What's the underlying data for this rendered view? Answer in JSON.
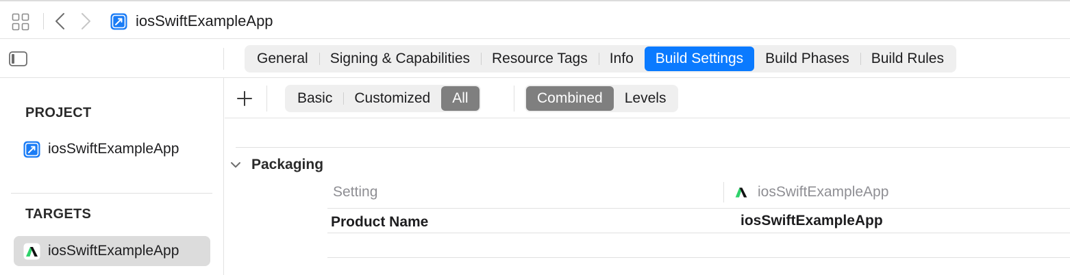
{
  "toolbar": {
    "title": "iosSwiftExampleApp",
    "icons": [
      "grid-icon",
      "back-chevron-icon",
      "forward-chevron-icon",
      "xcode-project-icon"
    ]
  },
  "editor_tabs": [
    {
      "label": "General",
      "active": false
    },
    {
      "label": "Signing & Capabilities",
      "active": false
    },
    {
      "label": "Resource Tags",
      "active": false
    },
    {
      "label": "Info",
      "active": false
    },
    {
      "label": "Build Settings",
      "active": true
    },
    {
      "label": "Build Phases",
      "active": false
    },
    {
      "label": "Build Rules",
      "active": false
    }
  ],
  "sidebar": {
    "project_heading": "PROJECT",
    "project_item": "iosSwiftExampleApp",
    "targets_heading": "TARGETS",
    "target_item": "iosSwiftExampleApp"
  },
  "filters": {
    "scope": [
      {
        "label": "Basic",
        "active": false
      },
      {
        "label": "Customized",
        "active": false
      },
      {
        "label": "All",
        "active": true
      }
    ],
    "view": [
      {
        "label": "Combined",
        "active": true
      },
      {
        "label": "Levels",
        "active": false
      }
    ]
  },
  "packaging": {
    "title": "Packaging",
    "column_setting": "Setting",
    "column_target": "iosSwiftExampleApp",
    "rows": [
      {
        "setting": "Product Name",
        "value": "iosSwiftExampleApp"
      }
    ]
  },
  "colors": {
    "accent": "#0a7aff",
    "segment_selected": "#7f7f7f",
    "target_icon_green": "#2fd26b"
  }
}
